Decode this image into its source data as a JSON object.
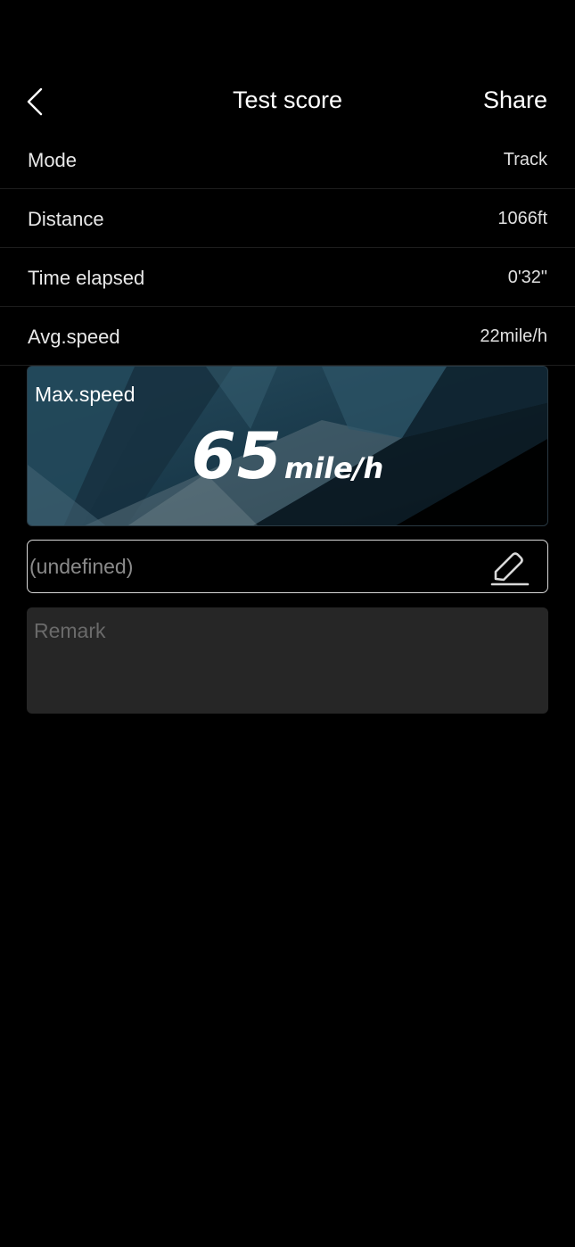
{
  "header": {
    "title": "Test score",
    "share_label": "Share",
    "back_icon": "chevron-left-icon"
  },
  "rows": [
    {
      "label": "Mode",
      "value": "Track"
    },
    {
      "label": "Distance",
      "value": "1066ft"
    },
    {
      "label": "Time elapsed",
      "value": "0'32\""
    },
    {
      "label": "Avg.speed",
      "value": "22mile/h"
    }
  ],
  "max_speed": {
    "label": "Max.speed",
    "value": "65",
    "unit": "mile/h"
  },
  "name_field": {
    "placeholder": "(undefined)",
    "edit_icon": "pencil-icon"
  },
  "remark": {
    "placeholder": "Remark"
  },
  "colors": {
    "background": "#000000",
    "text": "#ffffff",
    "card_bg": "#1b3544",
    "remark_bg": "#262626",
    "divider": "#1d1d1d"
  }
}
